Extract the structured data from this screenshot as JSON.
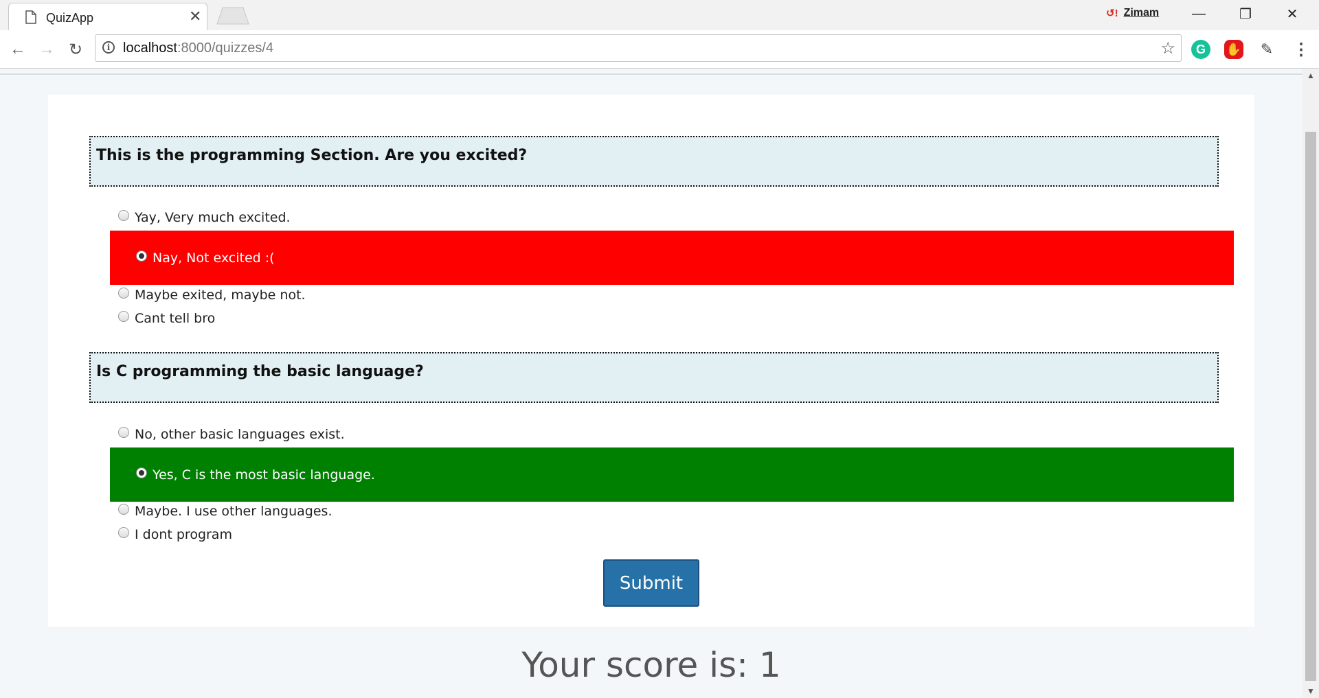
{
  "browser": {
    "tab_title": "QuizApp",
    "profile_name": "Zimam",
    "url_host": "localhost",
    "url_path": ":8000/quizzes/4"
  },
  "quiz": {
    "questions": [
      {
        "text": "This is the programming Section. Are you excited?",
        "options": [
          {
            "label": "Yay, Very much excited.",
            "selected": false
          },
          {
            "label": "Nay, Not excited :(",
            "selected": true,
            "highlight": "#ff0000"
          },
          {
            "label": "Maybe exited, maybe not.",
            "selected": false
          },
          {
            "label": "Cant tell bro",
            "selected": false
          }
        ]
      },
      {
        "text": "Is C programming the basic language?",
        "options": [
          {
            "label": "No, other basic languages exist.",
            "selected": false
          },
          {
            "label": "Yes, C is the most basic language.",
            "selected": true,
            "highlight": "#008000"
          },
          {
            "label": "Maybe. I use other languages.",
            "selected": false
          },
          {
            "label": "I dont program",
            "selected": false
          }
        ]
      }
    ],
    "submit_label": "Submit",
    "score_text": "Your score is: 1"
  },
  "colors": {
    "wrong": "#ff0000",
    "correct": "#008000",
    "question_bg": "#e2eff3",
    "submit_bg": "#2672a8"
  }
}
